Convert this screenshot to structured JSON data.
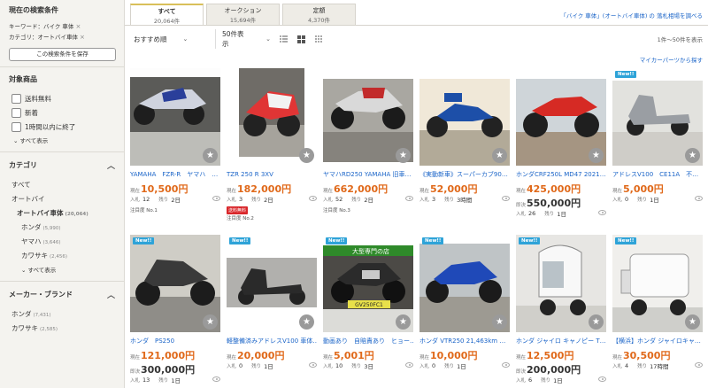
{
  "sidebar": {
    "current_conditions_title": "現在の検索条件",
    "keyword_label": "キーワード：バイク 車体",
    "category_label": "カテゴリ：オートバイ車体",
    "remove_mark": "×",
    "save_button": "この検索条件を保存",
    "target_title": "対象商品",
    "target_options": [
      "送料無料",
      "新着",
      "1時間以内に終了"
    ],
    "show_all": "すべて表示",
    "category_title": "カテゴリ",
    "categories": [
      {
        "label": "すべて",
        "count": ""
      },
      {
        "label": "オートバイ",
        "count": ""
      },
      {
        "label": "オートバイ車体",
        "count": "(20,064)"
      },
      {
        "label": "ホンダ",
        "count": "(5,990)"
      },
      {
        "label": "ヤマハ",
        "count": "(3,646)"
      },
      {
        "label": "カワサキ",
        "count": "(2,456)"
      }
    ],
    "category_show_all": "すべて表示",
    "maker_title": "メーカー・ブランド",
    "makers": [
      {
        "label": "ホンダ",
        "count": "(7,431)"
      },
      {
        "label": "カワサキ",
        "count": "(2,585)"
      }
    ],
    "chevron": "︿"
  },
  "tabs": [
    {
      "label": "すべて",
      "count": "20,064件"
    },
    {
      "label": "オークション",
      "count": "15,694件"
    },
    {
      "label": "定額",
      "count": "4,370件"
    }
  ],
  "top_link": "「バイク 車体」(オートバイ車体) の 落札相場を調べる",
  "toolbar": {
    "sort": "おすすめ順",
    "per_page": "50件表示",
    "caret": "⌄",
    "range": "1件～50件を表示"
  },
  "parts_link": "マイカーパーツから探す",
  "labels": {
    "current": "現在",
    "buy_now": "即決",
    "bids": "入札",
    "remaining": "残り",
    "star": "★",
    "new": "New!!"
  },
  "items": [
    {
      "title": "YAMAHA　FZR-R　ヤマハ　…",
      "price": "10,500円",
      "buy_now": "",
      "bids": "12",
      "remaining": "2日",
      "extra": "注目度 No.1",
      "sold": "",
      "is_new": false
    },
    {
      "title": "TZR 250 R 3XV",
      "price": "182,000円",
      "buy_now": "",
      "bids": "3",
      "remaining": "2日",
      "extra": "注目度 No.2",
      "sold": "送料無料",
      "is_new": false
    },
    {
      "title": "ヤマハRD250 YAMAHA 旧車…",
      "price": "662,000円",
      "buy_now": "",
      "bids": "52",
      "remaining": "2日",
      "extra": "注目度 No.3",
      "sold": "",
      "is_new": false
    },
    {
      "title": "《実動新車》スーパーカブ90…",
      "price": "52,000円",
      "buy_now": "",
      "bids": "3",
      "remaining": "3時間",
      "extra": "",
      "sold": "",
      "is_new": false
    },
    {
      "title": "ホンダCRF250L MD47 2021…",
      "price": "425,000円",
      "buy_now": "550,000円",
      "bids": "26",
      "remaining": "1日",
      "extra": "",
      "sold": "",
      "is_new": false
    },
    {
      "title": "アドレスV100　CE11A　不…",
      "price": "5,000円",
      "buy_now": "",
      "bids": "0",
      "remaining": "1日",
      "extra": "",
      "sold": "",
      "is_new": true
    },
    {
      "title": "ホンダ　PS250",
      "price": "121,000円",
      "buy_now": "300,000円",
      "bids": "13",
      "remaining": "1日",
      "extra": "",
      "sold": "",
      "is_new": true
    },
    {
      "title": "軽整備済みアドレスV100 車体…",
      "price": "20,000円",
      "buy_now": "",
      "bids": "0",
      "remaining": "1日",
      "extra": "",
      "sold": "",
      "is_new": true
    },
    {
      "title": "動画あり　自賠責あり　ヒョー…",
      "price": "5,001円",
      "buy_now": "",
      "bids": "10",
      "remaining": "3日",
      "extra": "",
      "sold": "",
      "is_new": true
    },
    {
      "title": "ホンダ VTR250 21,463km …",
      "price": "10,000円",
      "buy_now": "",
      "bids": "0",
      "remaining": "1日",
      "extra": "",
      "sold": "",
      "is_new": true
    },
    {
      "title": "ホンダ ジャイロ キャノピー T…",
      "price": "12,500円",
      "buy_now": "200,000円",
      "bids": "6",
      "remaining": "1日",
      "extra": "",
      "sold": "",
      "is_new": true
    },
    {
      "title": "【横浜】ホンダ ジャイロキャ…",
      "price": "30,500円",
      "buy_now": "",
      "bids": "4",
      "remaining": "17時間",
      "extra": "",
      "sold": "",
      "is_new": true
    }
  ],
  "image_text": {
    "item9": "大型専門の店",
    "item9_plate": "GV250FC1"
  }
}
